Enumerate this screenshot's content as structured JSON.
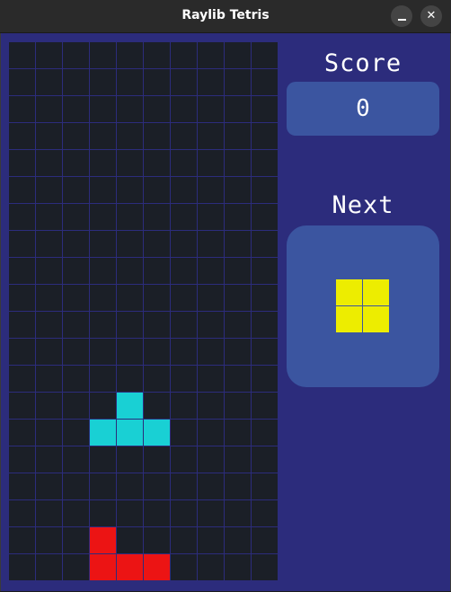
{
  "window": {
    "title": "Raylib Tetris",
    "minimize_icon": "minimize-icon",
    "close_icon": "close-icon",
    "close_glyph": "✕"
  },
  "game": {
    "score_label": "Score",
    "score_value": "0",
    "next_label": "Next",
    "board": {
      "columns": 10,
      "rows": 20
    },
    "colors": {
      "background": "#2c2c7c",
      "empty_cell": "#1b1f27",
      "grid_line": "#2c2c7c",
      "panel": "#3b55a0",
      "cyan": "#19d0d4",
      "red": "#ec1414",
      "yellow": "#eded00"
    },
    "cells": [
      {
        "row": 13,
        "col": 4,
        "color": "cyan"
      },
      {
        "row": 14,
        "col": 3,
        "color": "cyan"
      },
      {
        "row": 14,
        "col": 4,
        "color": "cyan"
      },
      {
        "row": 14,
        "col": 5,
        "color": "cyan"
      },
      {
        "row": 18,
        "col": 3,
        "color": "red"
      },
      {
        "row": 19,
        "col": 3,
        "color": "red"
      },
      {
        "row": 19,
        "col": 4,
        "color": "red"
      },
      {
        "row": 19,
        "col": 5,
        "color": "red"
      }
    ],
    "next_piece": {
      "type": "O",
      "color": "yellow",
      "cells": [
        {
          "row": 0,
          "col": 0
        },
        {
          "row": 0,
          "col": 1
        },
        {
          "row": 1,
          "col": 0
        },
        {
          "row": 1,
          "col": 1
        }
      ]
    }
  }
}
